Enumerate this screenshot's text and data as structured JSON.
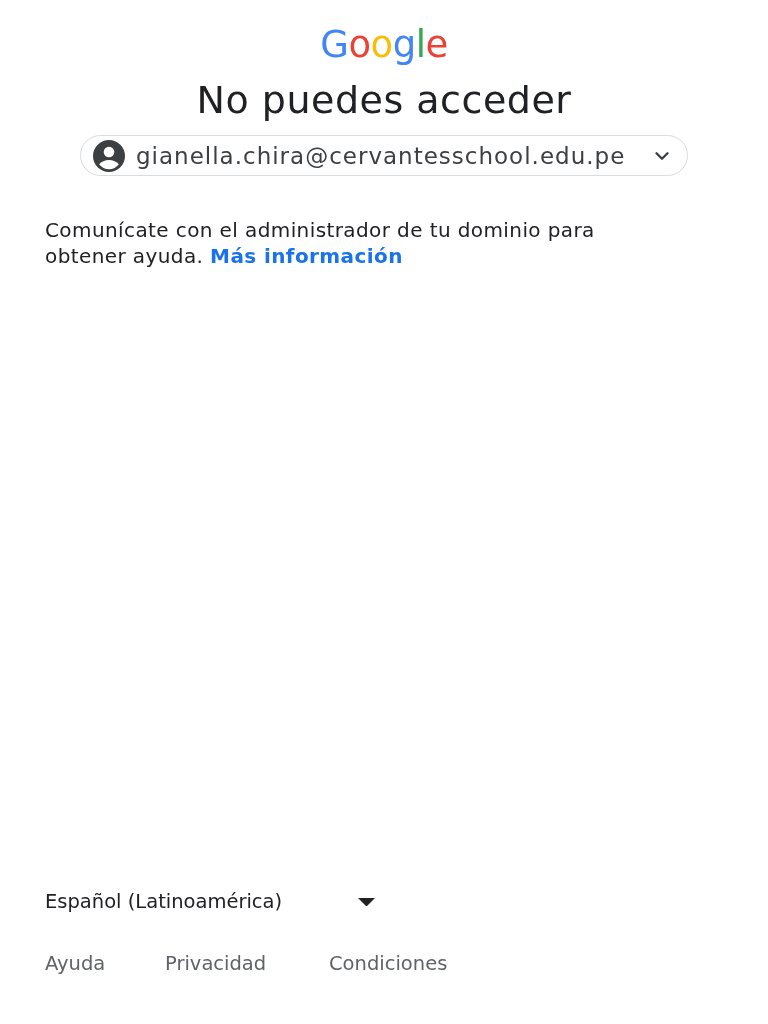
{
  "logo": {
    "text": "Google"
  },
  "heading": "No puedes acceder",
  "account": {
    "email": "gianella.chira@cervantesschool.edu.pe"
  },
  "message": {
    "text": "Comunícate con el administrador de tu dominio para obtener ayuda.",
    "link": "Más información"
  },
  "footer": {
    "language": "Español (Latinoamérica)",
    "links": [
      "Ayuda",
      "Privacidad",
      "Condiciones"
    ]
  }
}
